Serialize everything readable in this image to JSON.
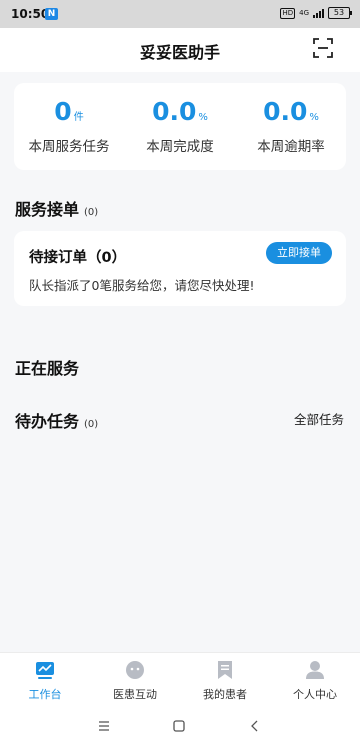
{
  "status_bar": {
    "time": "10:50",
    "app_badge": "N",
    "hd": "HD",
    "network": "4G",
    "battery": "53"
  },
  "header": {
    "title": "妥妥医助手"
  },
  "stats": [
    {
      "value": "0",
      "unit": "件",
      "label": "本周服务任务"
    },
    {
      "value": "0.0",
      "unit": "%",
      "label": "本周完成度"
    },
    {
      "value": "0.0",
      "unit": "%",
      "label": "本周逾期率"
    }
  ],
  "service_section": {
    "title": "服务接单",
    "count": "(0)"
  },
  "pending_order": {
    "title": "待接订单（0）",
    "button": "立即接单",
    "description": "队长指派了0笔服务给您，请您尽快处理!"
  },
  "in_service": {
    "title": "正在服务"
  },
  "todo": {
    "title": "待办任务",
    "count": "(0)",
    "all_link": "全部任务"
  },
  "tabs": [
    {
      "label": "工作台",
      "icon": "workbench-icon",
      "active": true
    },
    {
      "label": "医患互动",
      "icon": "chat-icon",
      "active": false
    },
    {
      "label": "我的患者",
      "icon": "bookmark-icon",
      "active": false
    },
    {
      "label": "个人中心",
      "icon": "person-icon",
      "active": false
    }
  ],
  "colors": {
    "accent": "#1a8fe0",
    "background": "#f6f7f9",
    "inactive_icon": "#b8bcc4"
  }
}
